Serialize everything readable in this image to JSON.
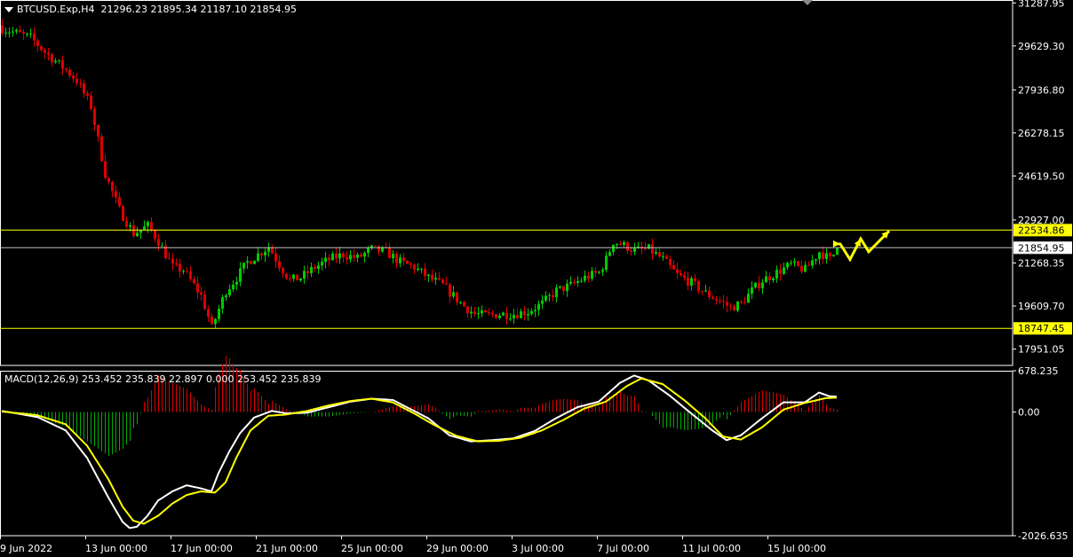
{
  "header": {
    "symbol": "BTCUSD.Exp,H4",
    "ohlc": "21296.23 21895.34 21187.10 21854.95"
  },
  "macd_header": "MACD(12,26,9) 253.452 235.839 22.897 0.000 253.452 235.839",
  "colors": {
    "background": "#000000",
    "frame": "#ffffff",
    "bull_candle": "#00cc00",
    "bear_candle": "#dd0000",
    "level_line": "#ffff00",
    "price_line": "#c0c0c0",
    "macd_line": "#ffffff",
    "signal_line": "#ffff00",
    "hist_pos": "#dd0000",
    "hist_neg": "#00aa00",
    "forecast_arrow": "#ffff00"
  },
  "chart_data": [
    {
      "type": "candlestick",
      "title": "BTCUSD.Exp,H4",
      "timeframe": "H4",
      "ylim": [
        17320,
        31400
      ],
      "y_ticks": [
        "31287.95",
        "29629.30",
        "27936.80",
        "26278.15",
        "24619.50",
        "22927.00",
        "21268.35",
        "19609.70",
        "17951.05"
      ],
      "x_ticks": [
        "9 Jun 2022",
        "13 Jun 00:00",
        "17 Jun 00:00",
        "21 Jun 00:00",
        "25 Jun 00:00",
        "29 Jun 00:00",
        "3 Jul 00:00",
        "7 Jul 00:00",
        "11 Jul 00:00",
        "15 Jul 00:00"
      ],
      "current_price": {
        "value": 21854.95,
        "label": "21854.95"
      },
      "levels": [
        {
          "value": 22534.86,
          "label": "22534.86"
        },
        {
          "value": 18747.45,
          "label": "18747.45"
        }
      ],
      "close_path": [
        [
          0,
          30300
        ],
        [
          8,
          29950
        ],
        [
          12,
          29400
        ],
        [
          18,
          28700
        ],
        [
          21,
          28300
        ],
        [
          25,
          27300
        ],
        [
          29,
          24700
        ],
        [
          33,
          23300
        ],
        [
          37,
          22400
        ],
        [
          41,
          22700
        ],
        [
          44,
          22100
        ],
        [
          48,
          21100
        ],
        [
          51,
          21000
        ],
        [
          54,
          20400
        ],
        [
          56,
          20000
        ],
        [
          58,
          19200
        ],
        [
          59,
          18750
        ],
        [
          61,
          19500
        ],
        [
          63,
          20200
        ],
        [
          66,
          20700
        ],
        [
          69,
          21300
        ],
        [
          73,
          21700
        ],
        [
          75,
          21900
        ],
        [
          78,
          21200
        ],
        [
          81,
          20600
        ],
        [
          84,
          20700
        ],
        [
          88,
          21100
        ],
        [
          92,
          21400
        ],
        [
          96,
          21600
        ],
        [
          100,
          21450
        ],
        [
          104,
          21800
        ],
        [
          108,
          21700
        ],
        [
          112,
          21300
        ],
        [
          116,
          21100
        ],
        [
          120,
          20700
        ],
        [
          124,
          20400
        ],
        [
          127,
          20000
        ],
        [
          130,
          19600
        ],
        [
          133,
          19300
        ],
        [
          136,
          19250
        ],
        [
          140,
          19300
        ],
        [
          144,
          19300
        ],
        [
          148,
          19400
        ],
        [
          152,
          19700
        ],
        [
          156,
          20200
        ],
        [
          160,
          20400
        ],
        [
          164,
          20700
        ],
        [
          168,
          20900
        ],
        [
          170,
          21400
        ],
        [
          172,
          22100
        ],
        [
          174,
          22000
        ],
        [
          178,
          21750
        ],
        [
          182,
          21800
        ],
        [
          186,
          21400
        ],
        [
          190,
          20800
        ],
        [
          194,
          20500
        ],
        [
          198,
          20100
        ],
        [
          202,
          19800
        ],
        [
          205,
          19550
        ],
        [
          208,
          19700
        ],
        [
          211,
          20200
        ],
        [
          214,
          20600
        ],
        [
          218,
          20900
        ],
        [
          222,
          21200
        ],
        [
          226,
          21000
        ],
        [
          230,
          21700
        ],
        [
          233,
          21400
        ],
        [
          235,
          21800
        ]
      ],
      "bar_count": 236,
      "forecast_path": [
        [
          21600,
          22000
        ],
        [
          21200,
          22350
        ],
        [
          21700,
          22500
        ]
      ]
    },
    {
      "type": "line",
      "title": "MACD(12,26,9)",
      "values": {
        "macd": 253.452,
        "signal": 235.839,
        "histogram": 22.897
      },
      "ylim": [
        -2026.635,
        678.235
      ],
      "y_ticks": [
        "678.235",
        "0.00",
        "-2026.635"
      ],
      "series": [
        {
          "name": "MACD",
          "points": [
            [
              0,
              20
            ],
            [
              10,
              -80
            ],
            [
              18,
              -300
            ],
            [
              24,
              -750
            ],
            [
              30,
              -1400
            ],
            [
              34,
              -1800
            ],
            [
              36,
              -1900
            ],
            [
              38,
              -1880
            ],
            [
              41,
              -1700
            ],
            [
              44,
              -1450
            ],
            [
              48,
              -1300
            ],
            [
              52,
              -1200
            ],
            [
              56,
              -1250
            ],
            [
              59,
              -1300
            ],
            [
              61,
              -1000
            ],
            [
              64,
              -650
            ],
            [
              67,
              -350
            ],
            [
              71,
              -90
            ],
            [
              76,
              20
            ],
            [
              80,
              -20
            ],
            [
              86,
              -10
            ],
            [
              92,
              80
            ],
            [
              98,
              170
            ],
            [
              104,
              220
            ],
            [
              110,
              200
            ],
            [
              114,
              80
            ],
            [
              120,
              -100
            ],
            [
              126,
              -380
            ],
            [
              132,
              -480
            ],
            [
              138,
              -460
            ],
            [
              144,
              -430
            ],
            [
              150,
              -310
            ],
            [
              156,
              -100
            ],
            [
              162,
              80
            ],
            [
              168,
              170
            ],
            [
              174,
              480
            ],
            [
              178,
              600
            ],
            [
              182,
              520
            ],
            [
              188,
              270
            ],
            [
              194,
              -20
            ],
            [
              200,
              -300
            ],
            [
              204,
              -460
            ],
            [
              208,
              -380
            ],
            [
              214,
              -100
            ],
            [
              220,
              160
            ],
            [
              226,
              160
            ],
            [
              230,
              320
            ],
            [
              233,
              260
            ],
            [
              235,
              253
            ]
          ]
        },
        {
          "name": "Signal",
          "points": [
            [
              0,
              10
            ],
            [
              10,
              -50
            ],
            [
              18,
              -200
            ],
            [
              24,
              -550
            ],
            [
              30,
              -1100
            ],
            [
              34,
              -1550
            ],
            [
              37,
              -1780
            ],
            [
              40,
              -1830
            ],
            [
              44,
              -1700
            ],
            [
              48,
              -1500
            ],
            [
              52,
              -1360
            ],
            [
              56,
              -1300
            ],
            [
              60,
              -1320
            ],
            [
              63,
              -1150
            ],
            [
              66,
              -750
            ],
            [
              70,
              -300
            ],
            [
              75,
              -60
            ],
            [
              80,
              -40
            ],
            [
              86,
              20
            ],
            [
              92,
              110
            ],
            [
              98,
              180
            ],
            [
              104,
              220
            ],
            [
              110,
              160
            ],
            [
              116,
              -20
            ],
            [
              122,
              -220
            ],
            [
              128,
              -390
            ],
            [
              134,
              -480
            ],
            [
              140,
              -470
            ],
            [
              146,
              -420
            ],
            [
              152,
              -300
            ],
            [
              158,
              -130
            ],
            [
              164,
              60
            ],
            [
              170,
              170
            ],
            [
              176,
              430
            ],
            [
              180,
              550
            ],
            [
              186,
              460
            ],
            [
              192,
              200
            ],
            [
              198,
              -100
            ],
            [
              203,
              -400
            ],
            [
              208,
              -450
            ],
            [
              214,
              -250
            ],
            [
              220,
              40
            ],
            [
              226,
              150
            ],
            [
              232,
              230
            ],
            [
              235,
              236
            ]
          ]
        }
      ],
      "histogram_marks": [
        [
          39,
          -1500
        ],
        [
          50,
          250
        ],
        [
          66,
          350
        ],
        [
          104,
          100
        ],
        [
          176,
          200
        ],
        [
          225,
          150
        ]
      ]
    }
  ]
}
